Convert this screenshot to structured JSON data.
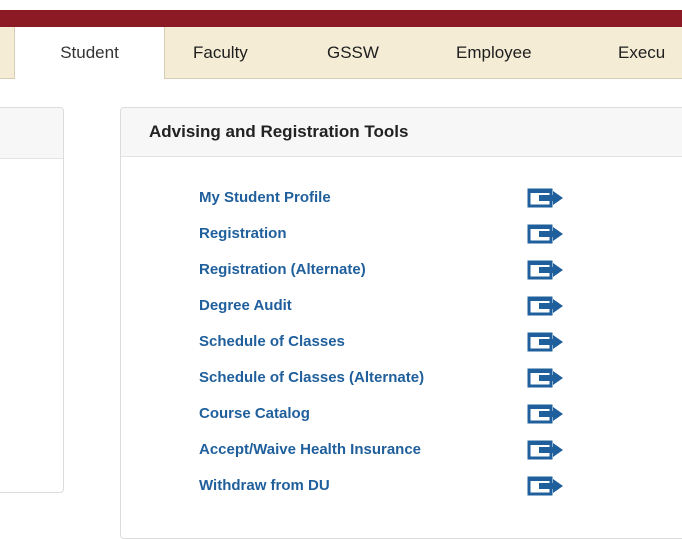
{
  "tabs": [
    {
      "label": "Student",
      "active": true
    },
    {
      "label": "Faculty",
      "active": false
    },
    {
      "label": "GSSW",
      "active": false
    },
    {
      "label": "Employee",
      "active": false
    },
    {
      "label": "Execu",
      "active": false
    }
  ],
  "panel": {
    "title": "Advising and Registration Tools",
    "items": [
      {
        "label": "My Student Profile",
        "icon": "external-link-icon"
      },
      {
        "label": "Registration",
        "icon": "external-link-icon"
      },
      {
        "label": "Registration (Alternate)",
        "icon": "external-link-icon"
      },
      {
        "label": "Degree Audit",
        "icon": "external-link-icon"
      },
      {
        "label": "Schedule of Classes",
        "icon": "external-link-icon"
      },
      {
        "label": "Schedule of Classes (Alternate)",
        "icon": "external-link-icon"
      },
      {
        "label": "Course Catalog",
        "icon": "external-link-icon"
      },
      {
        "label": "Accept/Waive Health Insurance",
        "icon": "external-link-icon"
      },
      {
        "label": "Withdraw from DU",
        "icon": "external-link-icon"
      }
    ]
  },
  "colors": {
    "brand_bar": "#8b1a24",
    "tab_background": "#f5ecd6",
    "link": "#1f5f9c",
    "icon": "#1f5f9c"
  }
}
